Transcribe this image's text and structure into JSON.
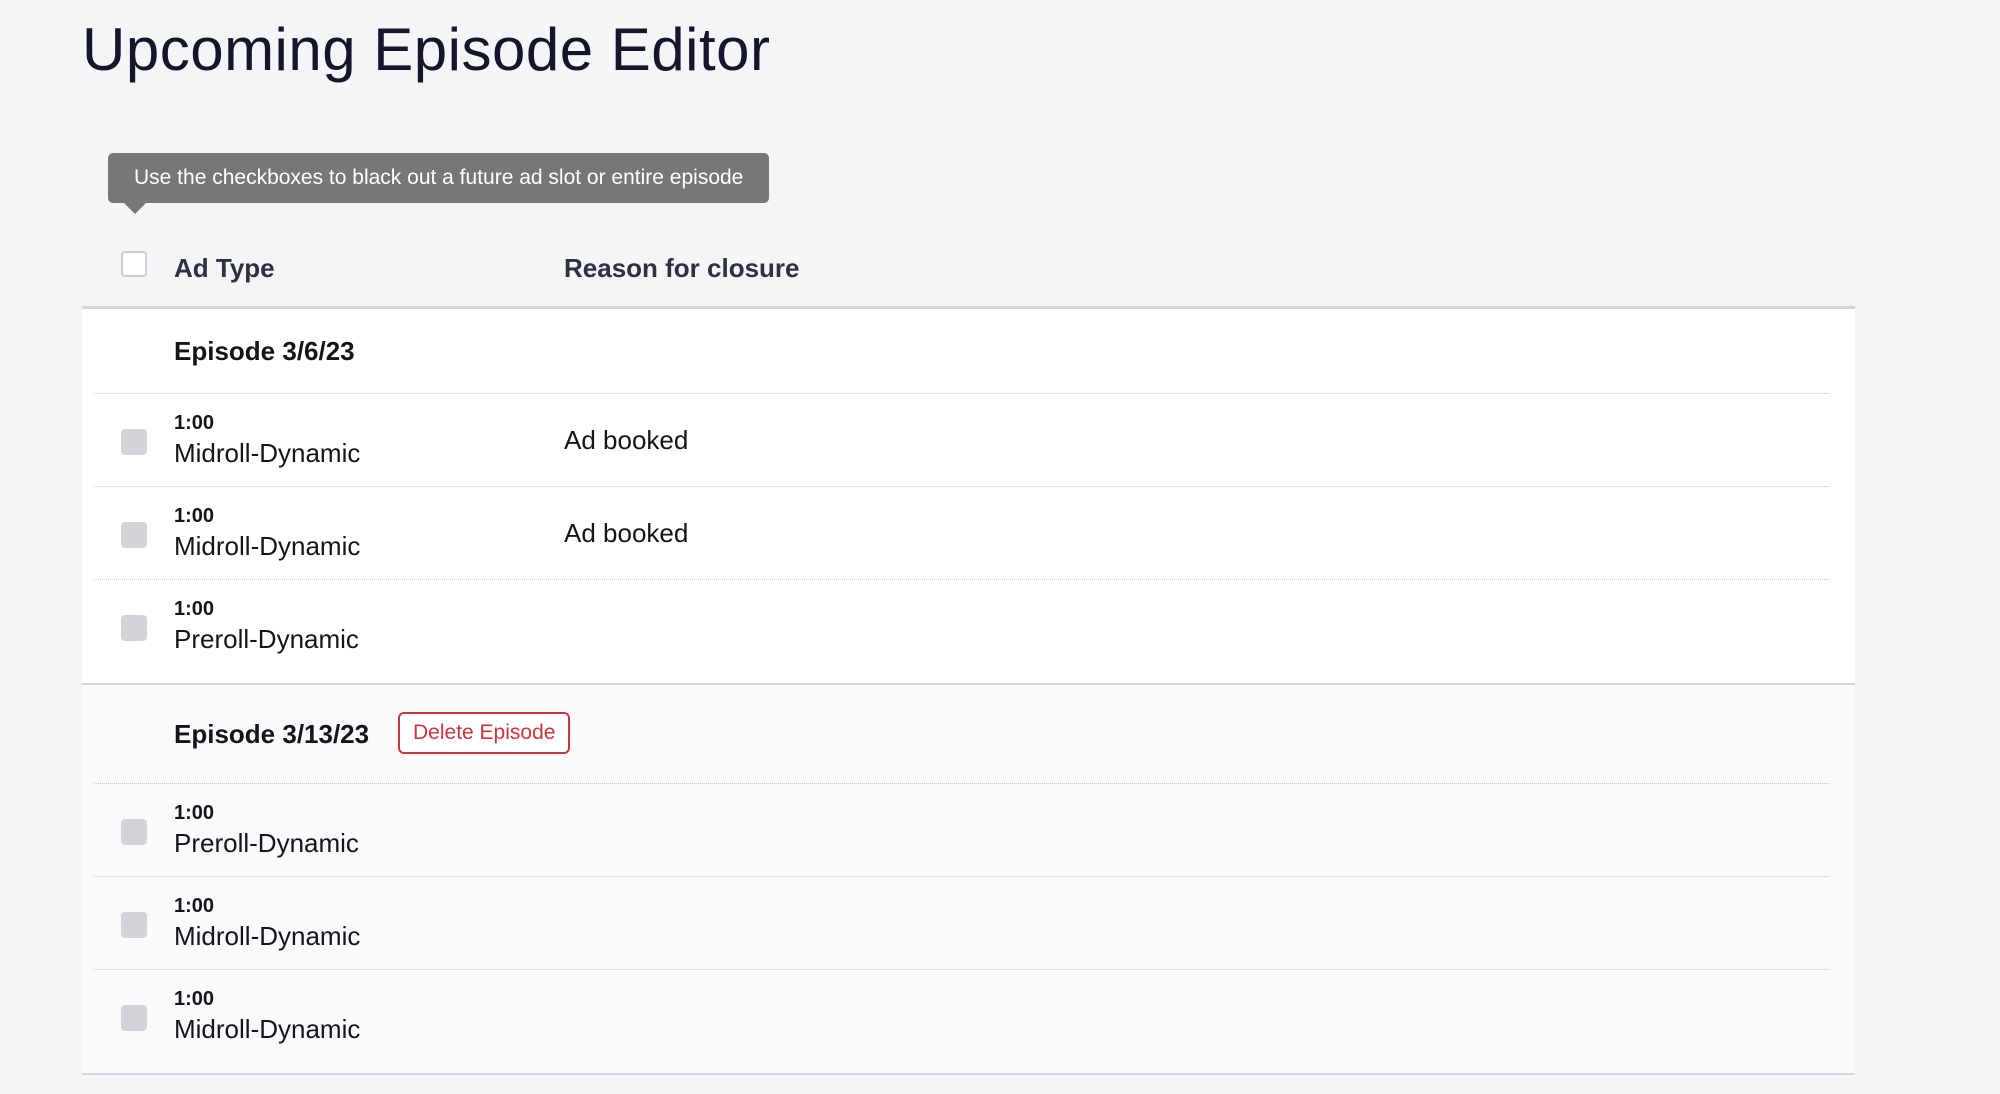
{
  "page": {
    "title": "Upcoming Episode Editor"
  },
  "tooltip": {
    "text": "Use the checkboxes to black out a future ad slot or entire episode"
  },
  "table": {
    "columns": {
      "ad_type": "Ad Type",
      "reason": "Reason for closure"
    },
    "episodes": [
      {
        "title": "Episode 3/6/23",
        "slots": [
          {
            "duration": "1:00",
            "type": "Midroll-Dynamic",
            "reason": "Ad booked",
            "checked": false
          },
          {
            "duration": "1:00",
            "type": "Midroll-Dynamic",
            "reason": "Ad booked",
            "checked": false
          },
          {
            "duration": "1:00",
            "type": "Preroll-Dynamic",
            "reason": "",
            "checked": false
          }
        ]
      },
      {
        "title": "Episode 3/13/23",
        "delete_label": "Delete Episode",
        "slots": [
          {
            "duration": "1:00",
            "type": "Preroll-Dynamic",
            "reason": "",
            "checked": false
          },
          {
            "duration": "1:00",
            "type": "Midroll-Dynamic",
            "reason": "",
            "checked": false
          },
          {
            "duration": "1:00",
            "type": "Midroll-Dynamic",
            "reason": "",
            "checked": false
          }
        ]
      }
    ]
  },
  "colors": {
    "background": "#f4f5f7",
    "tooltip_bg": "#777777",
    "delete_accent": "#c8373d",
    "disabled_checkbox": "#d3d4d7"
  }
}
